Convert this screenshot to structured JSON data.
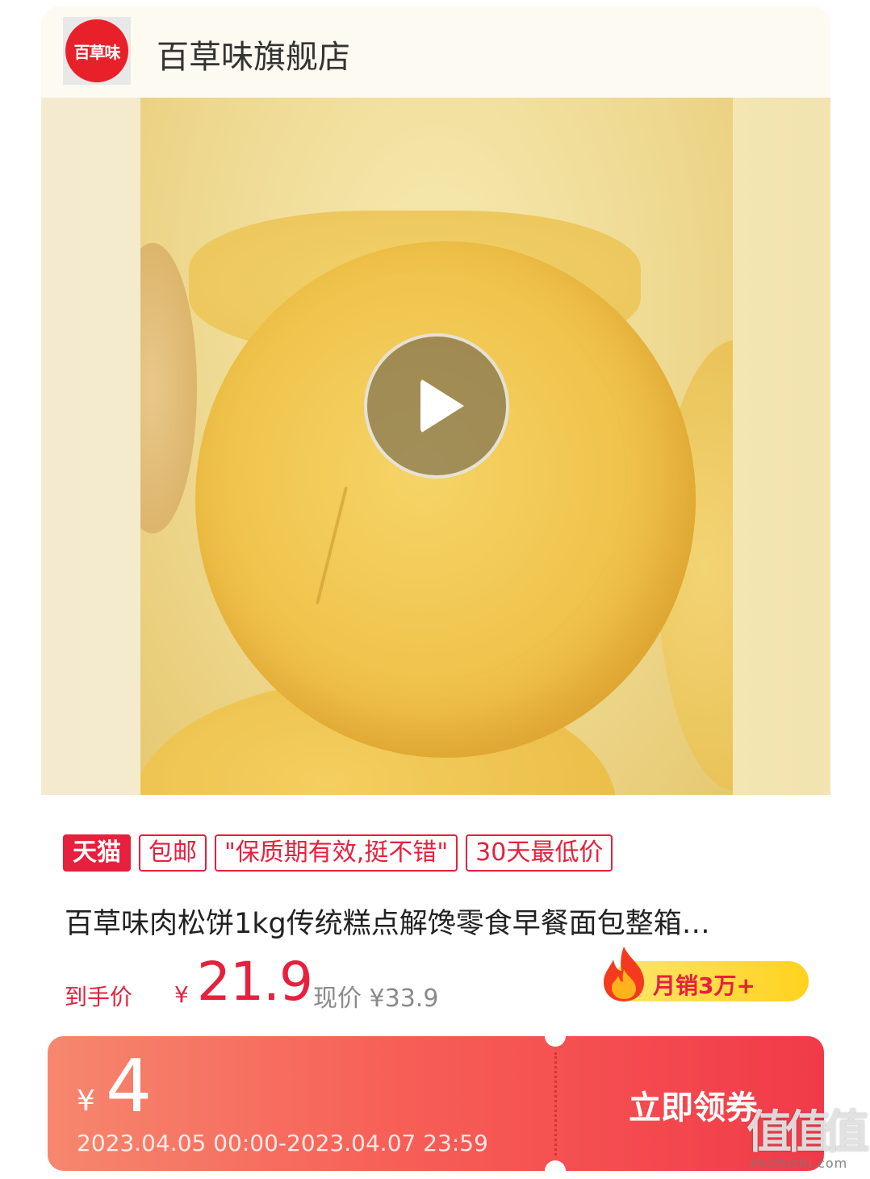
{
  "store": {
    "logo_text": "百草味",
    "name": "百草味旗舰店"
  },
  "media": {
    "play_icon": "play-icon"
  },
  "tags": [
    "天猫",
    "包邮",
    "\"保质期有效,挺不错\"",
    "30天最低价"
  ],
  "product": {
    "title": "百草味肉松饼1kg传统糕点解馋零食早餐面包整箱…"
  },
  "price": {
    "final_label": "到手价",
    "currency": "¥",
    "final_value": "21.9",
    "original_label": "现价 ¥33.9"
  },
  "sales": {
    "icon": "flame-icon",
    "text": "月销3万+"
  },
  "coupon": {
    "currency": "¥",
    "amount": "4",
    "validity": "2023.04.05 00:00-2023.04.07 23:59",
    "claim_label": "立即领券"
  },
  "watermark": {
    "mark": "值值值",
    "url": "zhizhizhi.com"
  },
  "colors": {
    "brand_red": "#e6203d",
    "coupon_gradient_start": "#f6876f",
    "coupon_gradient_end": "#f13a49",
    "sales_badge": "#ffd21f"
  }
}
